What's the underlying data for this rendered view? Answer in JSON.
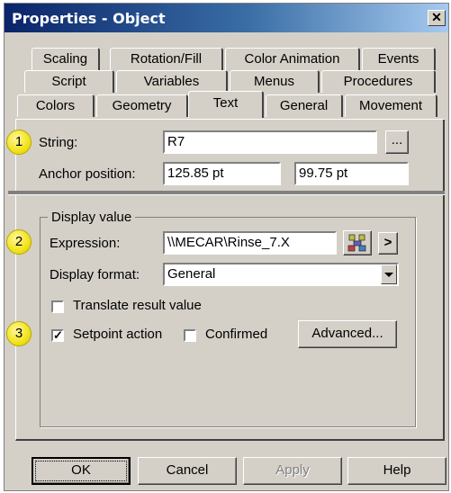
{
  "window": {
    "title": "Properties - Object",
    "close_glyph": "✕"
  },
  "tabs": {
    "row1": [
      "Scaling",
      "Rotation/Fill",
      "Color Animation",
      "Events"
    ],
    "row2": [
      "Script",
      "Variables",
      "Menus",
      "Procedures"
    ],
    "row3": [
      "Colors",
      "Geometry",
      "Text",
      "General",
      "Movement"
    ],
    "active": "Text"
  },
  "text_section": {
    "string_label": "String:",
    "string_value": "R7",
    "browse_label": "...",
    "anchor_label": "Anchor position:",
    "anchor_x": "125.85 pt",
    "anchor_y": "99.75 pt"
  },
  "display_value": {
    "group_label": "Display value",
    "expression_label": "Expression:",
    "expression_value": "\\\\MECAR\\Rinse_7.X",
    "arrow_label": ">",
    "format_label": "Display format:",
    "format_value": "General",
    "translate_label": "Translate result value",
    "translate_checked": false,
    "setpoint_label": "Setpoint action",
    "setpoint_checked": true,
    "setpoint_mark": "✓",
    "confirmed_label": "Confirmed",
    "confirmed_checked": false,
    "advanced_label": "Advanced..."
  },
  "badges": [
    "1",
    "2",
    "3"
  ],
  "footer": {
    "ok": "OK",
    "cancel": "Cancel",
    "apply": "Apply",
    "help": "Help"
  },
  "colors": {
    "badge": "#f2e21a",
    "dialog": "#d4d0c8",
    "title_start": "#0a246a"
  }
}
